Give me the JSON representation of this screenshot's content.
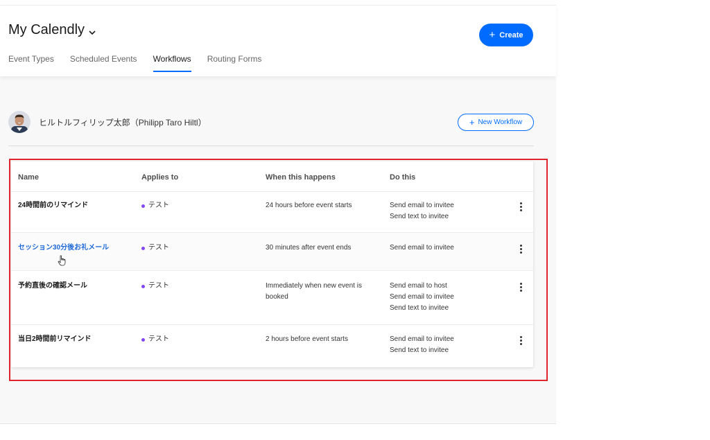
{
  "header": {
    "title": "My Calendly",
    "create_label": "Create",
    "tabs": [
      {
        "label": "Event Types",
        "active": false
      },
      {
        "label": "Scheduled Events",
        "active": false
      },
      {
        "label": "Workflows",
        "active": true
      },
      {
        "label": "Routing Forms",
        "active": false
      }
    ]
  },
  "user": {
    "name": "ヒルトルフィリップ太郎（Philipp Taro Hiltl）"
  },
  "new_workflow_label": "New Workflow",
  "table": {
    "columns": [
      "Name",
      "Applies to",
      "When this happens",
      "Do this"
    ],
    "rows": [
      {
        "name": "24時間前のリマインド",
        "applies_to": "テスト",
        "when": "24 hours before event starts",
        "actions": [
          "Send email to invitee",
          "Send text to invitee"
        ],
        "hovered": false
      },
      {
        "name": "セッション30分後お礼メール",
        "applies_to": "テスト",
        "when": "30 minutes after event ends",
        "actions": [
          "Send email to invitee"
        ],
        "hovered": true
      },
      {
        "name": "予約直後の確認メール",
        "applies_to": "テスト",
        "when": "Immediately when new event is booked",
        "actions": [
          "Send email to host",
          "Send email to invitee",
          "Send text to invitee"
        ],
        "hovered": false
      },
      {
        "name": "当日2時間前リマインド",
        "applies_to": "テスト",
        "when": "2 hours before event starts",
        "actions": [
          "Send email to invitee",
          "Send text to invitee"
        ],
        "hovered": false
      }
    ]
  },
  "colors": {
    "accent": "#006bff",
    "link": "#1f6ad8",
    "dot": "#8247f5",
    "highlight": "#e0242e"
  },
  "icons": [
    "chevron-down-icon",
    "plus-icon",
    "kebab-menu-icon",
    "hand-cursor-icon"
  ]
}
